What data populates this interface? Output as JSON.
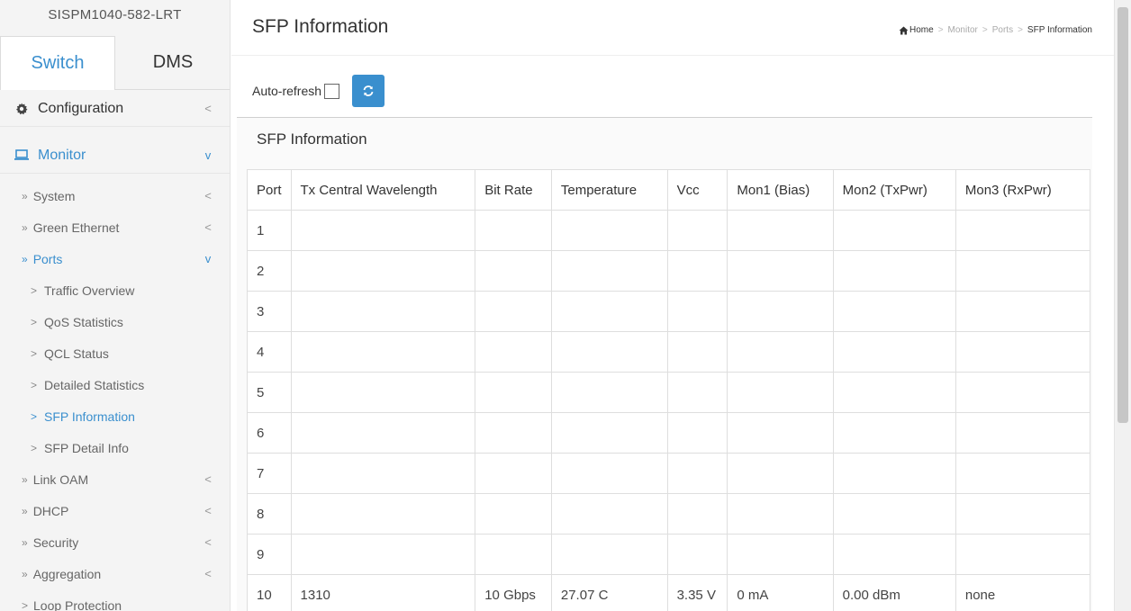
{
  "sidebar": {
    "device_name": "SISPM1040-582-LRT",
    "tabs": [
      {
        "label": "Switch",
        "active": true
      },
      {
        "label": "DMS",
        "active": false
      }
    ],
    "menu": {
      "configuration": {
        "label": "Configuration",
        "icon": "gear-icon",
        "chevron": "<"
      },
      "monitor": {
        "label": "Monitor",
        "icon": "monitor-icon",
        "chevron": "v"
      },
      "system": {
        "prefix": "»",
        "label": "System",
        "chevron": "<"
      },
      "green_ethernet": {
        "prefix": "»",
        "label": "Green Ethernet",
        "chevron": "<"
      },
      "ports": {
        "prefix": "»",
        "label": "Ports",
        "chevron": "v"
      },
      "traffic_overview": {
        "prefix": ">",
        "label": "Traffic Overview"
      },
      "qos_statistics": {
        "prefix": ">",
        "label": "QoS Statistics"
      },
      "qcl_status": {
        "prefix": ">",
        "label": "QCL Status"
      },
      "detailed_statistics": {
        "prefix": ">",
        "label": "Detailed Statistics"
      },
      "sfp_information": {
        "prefix": ">",
        "label": "SFP Information"
      },
      "sfp_detail_info": {
        "prefix": ">",
        "label": "SFP Detail Info"
      },
      "link_oam": {
        "prefix": "»",
        "label": "Link OAM",
        "chevron": "<"
      },
      "dhcp": {
        "prefix": "»",
        "label": "DHCP",
        "chevron": "<"
      },
      "security": {
        "prefix": "»",
        "label": "Security",
        "chevron": "<"
      },
      "aggregation": {
        "prefix": "»",
        "label": "Aggregation",
        "chevron": "<"
      },
      "loop_protection": {
        "prefix": ">",
        "label": "Loop Protection"
      }
    }
  },
  "header": {
    "title": "SFP Information",
    "breadcrumb": {
      "home": "Home",
      "separator": ">",
      "monitor": "Monitor",
      "ports": "Ports",
      "current": "SFP Information"
    }
  },
  "controls": {
    "auto_refresh_label": "Auto-refresh",
    "auto_refresh_checked": false
  },
  "panel": {
    "title": "SFP Information",
    "columns": [
      "Port",
      "Tx Central Wavelength",
      "Bit Rate",
      "Temperature",
      "Vcc",
      "Mon1 (Bias)",
      "Mon2 (TxPwr)",
      "Mon3 (RxPwr)"
    ],
    "rows": [
      [
        "1",
        "",
        "",
        "",
        "",
        "",
        "",
        ""
      ],
      [
        "2",
        "",
        "",
        "",
        "",
        "",
        "",
        ""
      ],
      [
        "3",
        "",
        "",
        "",
        "",
        "",
        "",
        ""
      ],
      [
        "4",
        "",
        "",
        "",
        "",
        "",
        "",
        ""
      ],
      [
        "5",
        "",
        "",
        "",
        "",
        "",
        "",
        ""
      ],
      [
        "6",
        "",
        "",
        "",
        "",
        "",
        "",
        ""
      ],
      [
        "7",
        "",
        "",
        "",
        "",
        "",
        "",
        ""
      ],
      [
        "8",
        "",
        "",
        "",
        "",
        "",
        "",
        ""
      ],
      [
        "9",
        "",
        "",
        "",
        "",
        "",
        "",
        ""
      ],
      [
        "10",
        "1310",
        "10 Gbps",
        "27.07 C",
        "3.35 V",
        "0 mA",
        "0.00 dBm",
        "none"
      ]
    ]
  },
  "colors": {
    "accent": "#3a8fce",
    "sidebar_bg": "#f4f4f4",
    "border": "#dedede"
  }
}
